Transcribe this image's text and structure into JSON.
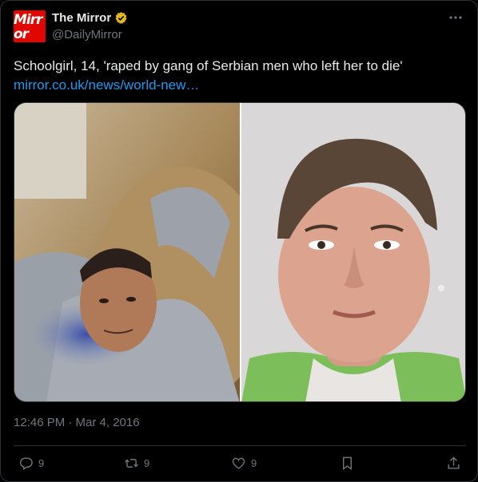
{
  "author": {
    "avatar_text": "Mirror",
    "display_name": "The Mirror",
    "handle": "@DailyMirror",
    "verified_icon": "verified-gold-badge"
  },
  "tweet": {
    "text": "Schoolgirl, 14, 'raped by gang of Serbian men who left her to die'",
    "link_text": "mirror.co.uk/news/world-new…",
    "timestamp": "12:46 PM · Mar 4, 2016"
  },
  "media": {
    "left_photo": "selfie-of-young-man-in-grey-hoodie",
    "right_photo": "police-mugshot-young-man-green-shirt"
  },
  "actions": {
    "reply_count": "9",
    "retweet_count": "9",
    "like_count": "9"
  },
  "colors": {
    "background": "#000000",
    "text": "#e7e9ea",
    "muted": "#71767b",
    "link": "#1d9bf0",
    "brand_red": "#e10600"
  }
}
